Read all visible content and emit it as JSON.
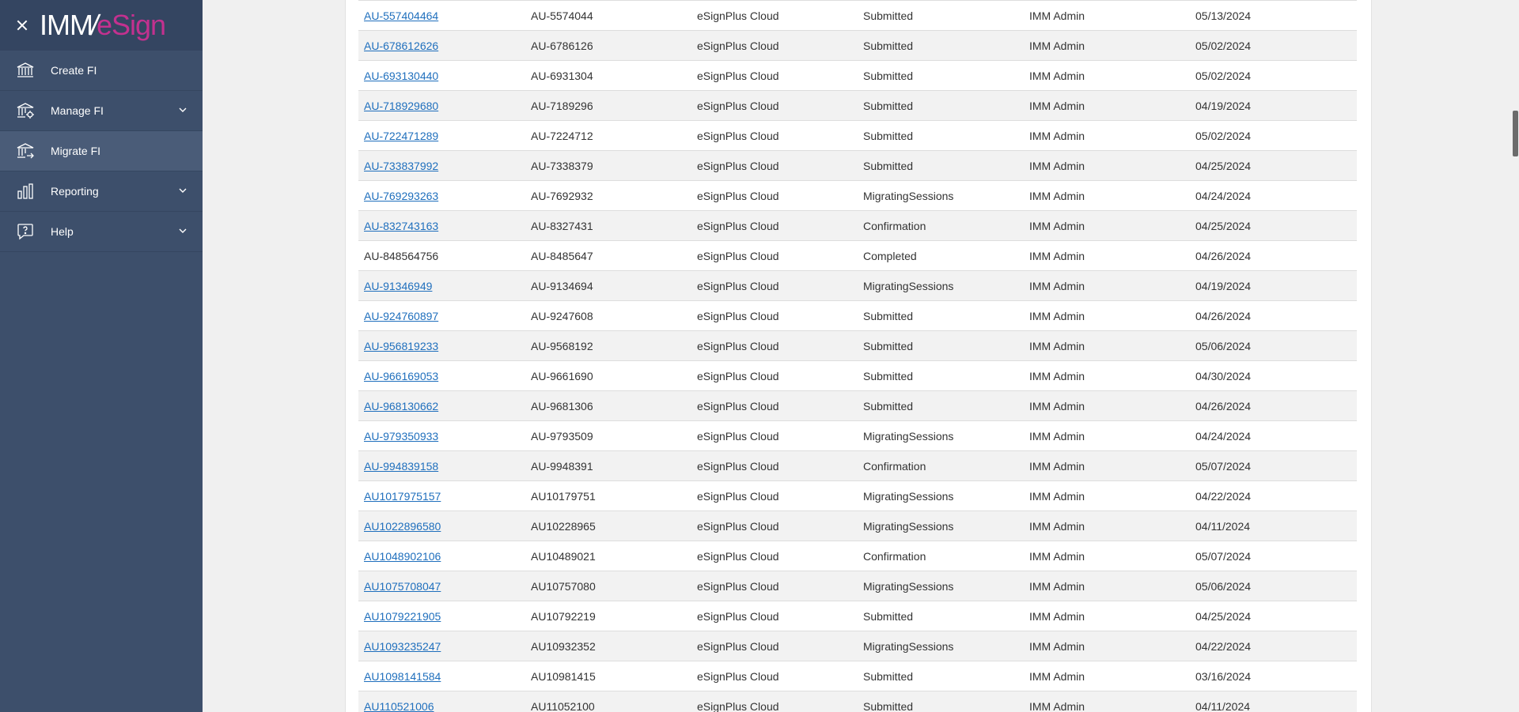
{
  "brand": {
    "imm": "IMM",
    "slash": "/",
    "esign": "eSign"
  },
  "sidebar": {
    "items": [
      {
        "label": "Create FI",
        "icon": "bank-icon",
        "chevron": false,
        "active": false
      },
      {
        "label": "Manage FI",
        "icon": "bank-gear-icon",
        "chevron": true,
        "active": false
      },
      {
        "label": "Migrate FI",
        "icon": "bank-migrate-icon",
        "chevron": false,
        "active": true
      },
      {
        "label": "Reporting",
        "icon": "bar-chart-icon",
        "chevron": true,
        "active": false
      },
      {
        "label": "Help",
        "icon": "help-bubble-icon",
        "chevron": true,
        "active": false
      }
    ]
  },
  "table": {
    "rows": [
      [
        "AU-557404464",
        "AU-5574044",
        "eSignPlus Cloud",
        "Submitted",
        "IMM Admin",
        "05/13/2024",
        true
      ],
      [
        "AU-678612626",
        "AU-6786126",
        "eSignPlus Cloud",
        "Submitted",
        "IMM Admin",
        "05/02/2024",
        true
      ],
      [
        "AU-693130440",
        "AU-6931304",
        "eSignPlus Cloud",
        "Submitted",
        "IMM Admin",
        "05/02/2024",
        true
      ],
      [
        "AU-718929680",
        "AU-7189296",
        "eSignPlus Cloud",
        "Submitted",
        "IMM Admin",
        "04/19/2024",
        true
      ],
      [
        "AU-722471289",
        "AU-7224712",
        "eSignPlus Cloud",
        "Submitted",
        "IMM Admin",
        "05/02/2024",
        true
      ],
      [
        "AU-733837992",
        "AU-7338379",
        "eSignPlus Cloud",
        "Submitted",
        "IMM Admin",
        "04/25/2024",
        true
      ],
      [
        "AU-769293263",
        "AU-7692932",
        "eSignPlus Cloud",
        "MigratingSessions",
        "IMM Admin",
        "04/24/2024",
        true
      ],
      [
        "AU-832743163",
        "AU-8327431",
        "eSignPlus Cloud",
        "Confirmation",
        "IMM Admin",
        "04/25/2024",
        true
      ],
      [
        "AU-848564756",
        "AU-8485647",
        "eSignPlus Cloud",
        "Completed",
        "IMM Admin",
        "04/26/2024",
        false
      ],
      [
        "AU-91346949",
        "AU-9134694",
        "eSignPlus Cloud",
        "MigratingSessions",
        "IMM Admin",
        "04/19/2024",
        true
      ],
      [
        "AU-924760897",
        "AU-9247608",
        "eSignPlus Cloud",
        "Submitted",
        "IMM Admin",
        "04/26/2024",
        true
      ],
      [
        "AU-956819233",
        "AU-9568192",
        "eSignPlus Cloud",
        "Submitted",
        "IMM Admin",
        "05/06/2024",
        true
      ],
      [
        "AU-966169053",
        "AU-9661690",
        "eSignPlus Cloud",
        "Submitted",
        "IMM Admin",
        "04/30/2024",
        true
      ],
      [
        "AU-968130662",
        "AU-9681306",
        "eSignPlus Cloud",
        "Submitted",
        "IMM Admin",
        "04/26/2024",
        true
      ],
      [
        "AU-979350933",
        "AU-9793509",
        "eSignPlus Cloud",
        "MigratingSessions",
        "IMM Admin",
        "04/24/2024",
        true
      ],
      [
        "AU-994839158",
        "AU-9948391",
        "eSignPlus Cloud",
        "Confirmation",
        "IMM Admin",
        "05/07/2024",
        true
      ],
      [
        "AU1017975157",
        "AU10179751",
        "eSignPlus Cloud",
        "MigratingSessions",
        "IMM Admin",
        "04/22/2024",
        true
      ],
      [
        "AU1022896580",
        "AU10228965",
        "eSignPlus Cloud",
        "MigratingSessions",
        "IMM Admin",
        "04/11/2024",
        true
      ],
      [
        "AU1048902106",
        "AU10489021",
        "eSignPlus Cloud",
        "Confirmation",
        "IMM Admin",
        "05/07/2024",
        true
      ],
      [
        "AU1075708047",
        "AU10757080",
        "eSignPlus Cloud",
        "MigratingSessions",
        "IMM Admin",
        "05/06/2024",
        true
      ],
      [
        "AU1079221905",
        "AU10792219",
        "eSignPlus Cloud",
        "Submitted",
        "IMM Admin",
        "04/25/2024",
        true
      ],
      [
        "AU1093235247",
        "AU10932352",
        "eSignPlus Cloud",
        "MigratingSessions",
        "IMM Admin",
        "04/22/2024",
        true
      ],
      [
        "AU1098141584",
        "AU10981415",
        "eSignPlus Cloud",
        "Submitted",
        "IMM Admin",
        "03/16/2024",
        true
      ],
      [
        "AU110521006",
        "AU11052100",
        "eSignPlus Cloud",
        "Submitted",
        "IMM Admin",
        "04/11/2024",
        true
      ]
    ]
  }
}
